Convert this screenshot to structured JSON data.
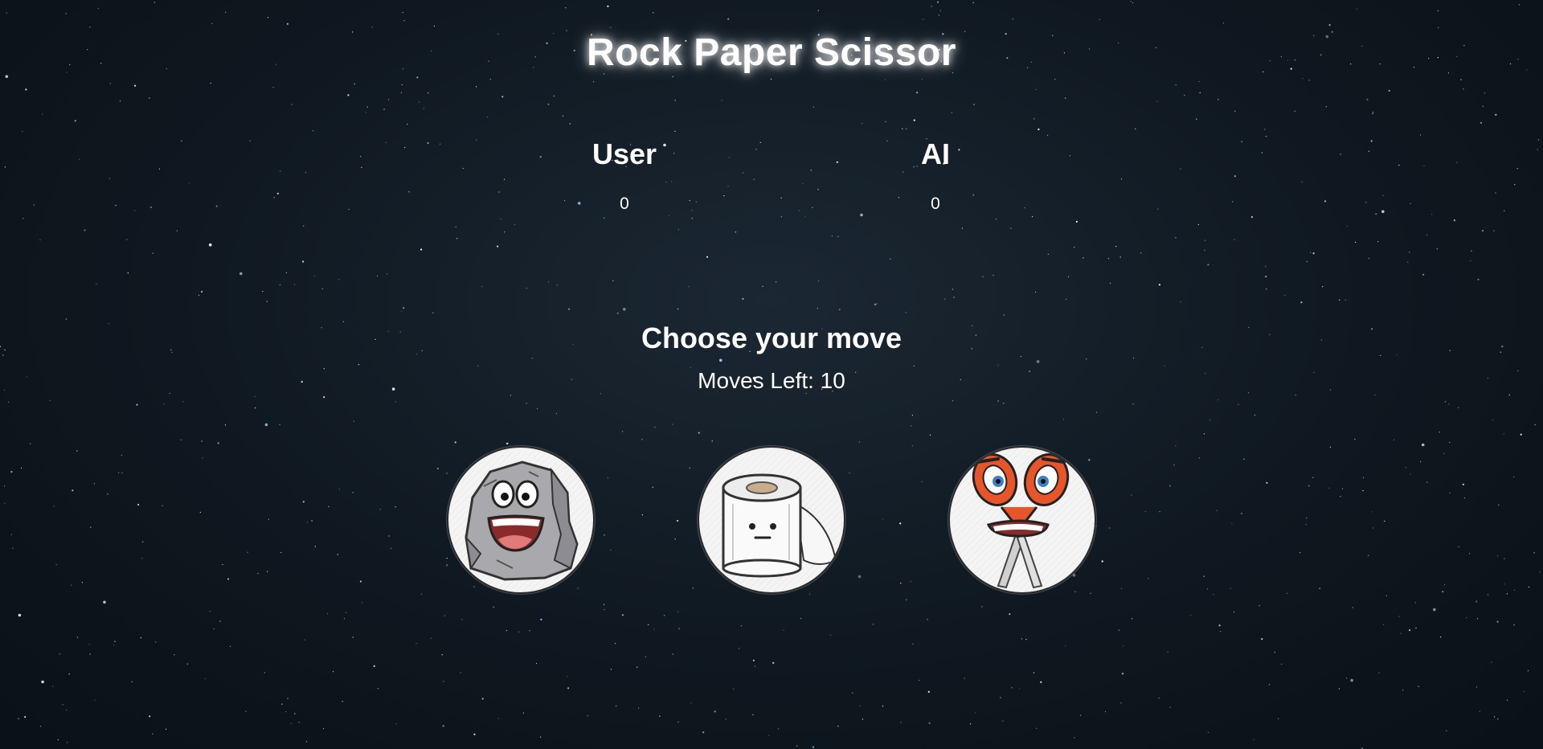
{
  "title": "Rock Paper Scissor",
  "scoreboard": {
    "user_label": "User",
    "user_score": "0",
    "ai_label": "AI",
    "ai_score": "0"
  },
  "prompt": "Choose your move",
  "moves_left": "Moves Left: 10",
  "choices": [
    {
      "id": "rock",
      "icon": "rock-character-icon"
    },
    {
      "id": "paper",
      "icon": "toilet-paper-character-icon"
    },
    {
      "id": "scissor",
      "icon": "scissors-character-icon"
    }
  ],
  "colors": {
    "text": "#ffffff",
    "background": "#0f1820",
    "choice_bg": "#f4f4f4",
    "scissor_orange": "#e8552a"
  }
}
